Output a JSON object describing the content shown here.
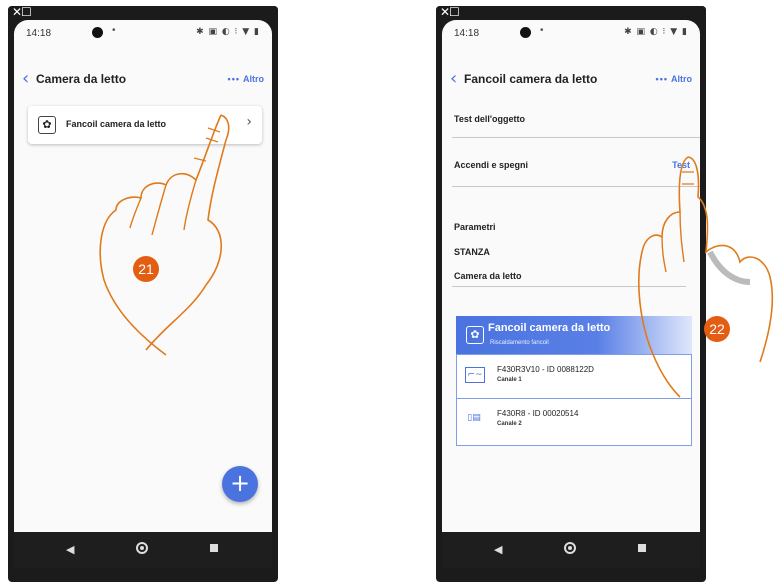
{
  "screen1": {
    "time": "14:18",
    "notif": "•",
    "status_icons": "✱ ▣ ◐ ⁝ ▼ ▮",
    "back_icon": "‹",
    "title": "Camera da letto",
    "more_dots": "•••",
    "more_label": "Altro",
    "device_label": "Fancoil camera da letto",
    "fab_icon": "+",
    "badge": "21"
  },
  "screen2": {
    "time": "14:18",
    "notif": "•",
    "status_icons": "✱ ▣ ◐ ⁝ ▼ ▮",
    "back_icon": "‹",
    "title": "Fancoil camera da letto",
    "more_dots": "•••",
    "more_label": "Altro",
    "object_test_label": "Test dell'oggetto",
    "onoff_label": "Accendi e spegni",
    "test_link": "Test",
    "params_label": "Parametri",
    "room_label": "STANZA",
    "room_value": "Camera da letto",
    "panel": {
      "title": "Fancoil camera da letto",
      "subtitle": "Riscaldamento fancoil",
      "devices": [
        {
          "name": "F430R3V10 - ID 0088122D",
          "channel": "Canale 1"
        },
        {
          "name": "F430R8 - ID 00020514",
          "channel": "Canale 2"
        }
      ]
    },
    "badge": "22"
  },
  "nav": {
    "back": "◀"
  },
  "colors": {
    "accent": "#4a73e0",
    "badge": "#e35d12",
    "hand_outline": "#e07a1a"
  }
}
